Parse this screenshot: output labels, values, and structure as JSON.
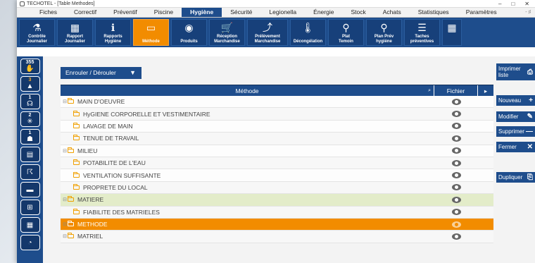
{
  "window": {
    "title": "TECHOTEL - [Table Methodes]",
    "controls": [
      "–",
      "□",
      "✕"
    ]
  },
  "menubar": {
    "items": [
      {
        "label": "Fiches",
        "active": false
      },
      {
        "label": "Correctif",
        "active": false
      },
      {
        "label": "Préventif",
        "active": false
      },
      {
        "label": "Piscine",
        "active": false
      },
      {
        "label": "Hygiène",
        "active": true
      },
      {
        "label": "Sécurité",
        "active": false
      },
      {
        "label": "Legionella",
        "active": false
      },
      {
        "label": "Énergie",
        "active": false
      },
      {
        "label": "Stock",
        "active": false
      },
      {
        "label": "Achats",
        "active": false
      },
      {
        "label": "Statistiques",
        "active": false
      },
      {
        "label": "Paramètres",
        "active": false
      }
    ],
    "right_mini": "- ♯ "
  },
  "toolbar": {
    "buttons": [
      {
        "label": "Contrôle\nJournalier",
        "icon": "flask-icon",
        "glyph": "⚗"
      },
      {
        "label": "Rapport\nJournalier",
        "icon": "calculator-icon",
        "glyph": "▦"
      },
      {
        "label": "Rapports\nHygiène",
        "icon": "info-icon",
        "glyph": "ℹ"
      },
      {
        "label": "Méthode",
        "icon": "book-icon",
        "glyph": "▭",
        "active": true
      },
      {
        "label": "Produits",
        "icon": "product-icon",
        "glyph": "◉"
      },
      {
        "label": "Réception\nMarchandise",
        "icon": "cart-icon",
        "glyph": "🛒"
      },
      {
        "label": "Prélèvement\nMarchandise",
        "icon": "hand-icon",
        "glyph": "⤴"
      },
      {
        "label": "Décongélation",
        "icon": "thermometer-icon",
        "glyph": "🌡"
      },
      {
        "label": "Plat\nTemoin",
        "icon": "sample-icon",
        "glyph": "⚲"
      },
      {
        "label": "Plan Prév\nhygiène",
        "icon": "location-icon",
        "glyph": "⚲"
      },
      {
        "label": "Taches\npréventives",
        "icon": "tasks-icon",
        "glyph": "☰"
      },
      {
        "label": "",
        "icon": "calendar-icon",
        "glyph": "▦"
      }
    ]
  },
  "sidebar": {
    "items": [
      {
        "badge": "355",
        "badge_color": "white",
        "icon": "thumbs-down-icon",
        "glyph": "✋"
      },
      {
        "badge": "3",
        "badge_color": "orange",
        "icon": "alert-person-icon",
        "glyph": "▲"
      },
      {
        "badge": "1",
        "badge_color": "white",
        "icon": "headset-icon",
        "glyph": "☊"
      },
      {
        "badge": "2",
        "badge_color": "white",
        "icon": "sun-icon",
        "glyph": "✳"
      },
      {
        "badge": "1",
        "badge_color": "white",
        "icon": "hand-bucket-icon",
        "glyph": "☗"
      },
      {
        "badge": "",
        "badge_color": "white",
        "icon": "document-icon",
        "glyph": "▤"
      },
      {
        "badge": "",
        "badge_color": "white",
        "icon": "worker-icon",
        "glyph": "☈"
      },
      {
        "badge": "",
        "badge_color": "white",
        "icon": "truck-icon",
        "glyph": "▬"
      },
      {
        "badge": "",
        "badge_color": "white",
        "icon": "org-chart-icon",
        "glyph": "⊞"
      },
      {
        "badge": "",
        "badge_color": "white",
        "icon": "calendar-icon",
        "glyph": "▦"
      },
      {
        "badge": "",
        "badge_color": "white",
        "icon": "gauge-icon",
        "glyph": "◔"
      }
    ]
  },
  "main": {
    "dropdown_label": "Enrouler / Dérouler",
    "dropdown_caret": "▼",
    "columns": {
      "method": "Méthode",
      "file": "Fichier"
    },
    "rows": [
      {
        "label": "MAIN D'OEUVRE",
        "level": 0,
        "style": "white"
      },
      {
        "label": "HyGIENE CORPORELLE ET VESTIMENTAIRE",
        "level": 1,
        "style": "alt"
      },
      {
        "label": "LAVAGE DE MAIN",
        "level": 1,
        "style": "white"
      },
      {
        "label": "TENUE DE TRAVAIL",
        "level": 1,
        "style": "alt"
      },
      {
        "label": "MILIEU",
        "level": 0,
        "style": "white"
      },
      {
        "label": "POTABILITE DE L'EAU",
        "level": 1,
        "style": "alt"
      },
      {
        "label": "VENTILATION SUFFISANTE",
        "level": 1,
        "style": "white"
      },
      {
        "label": "PROPRETE DU LOCAL",
        "level": 1,
        "style": "alt"
      },
      {
        "label": "MATIERE",
        "level": 0,
        "style": "hl-green"
      },
      {
        "label": "FIABILITE DES MATRIELES",
        "level": 1,
        "style": "alt"
      },
      {
        "label": "METHODE",
        "level": 0,
        "style": "selected"
      },
      {
        "label": "MATRIEL",
        "level": 0,
        "style": "alt"
      }
    ]
  },
  "rightpanel": {
    "buttons": [
      {
        "label": "Imprimer\nliste",
        "glyph": "⎙"
      },
      {
        "label": "Nouveau",
        "glyph": "+"
      },
      {
        "label": "Modifier",
        "glyph": "✎"
      },
      {
        "label": "Supprimer",
        "glyph": "—"
      },
      {
        "label": "Fermer",
        "glyph": "✕"
      },
      {
        "label": "Dupliquer",
        "glyph": "⎘"
      }
    ]
  },
  "colors": {
    "primary": "#1e4d8c",
    "accent": "#f28c00",
    "highlight": "#e3ecc9"
  }
}
